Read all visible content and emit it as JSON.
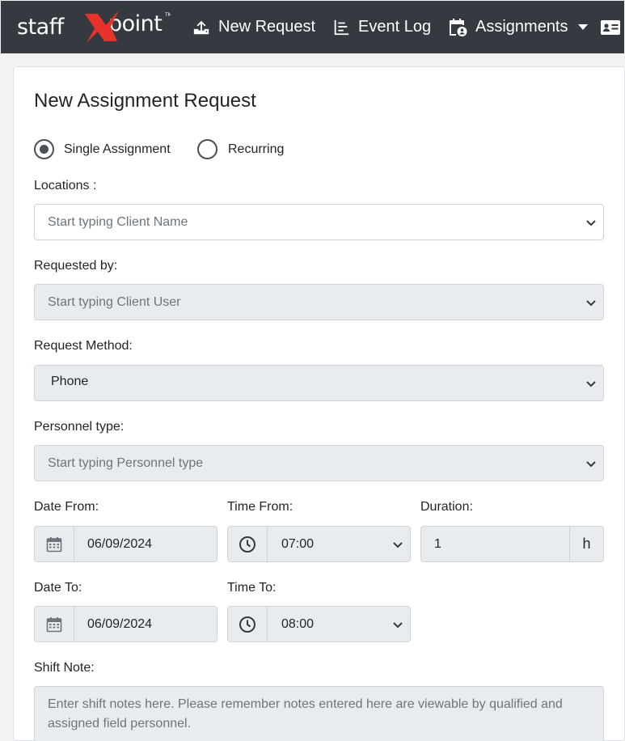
{
  "navbar": {
    "logo_text": "staffpoint",
    "new_request": "New Request",
    "event_log": "Event Log",
    "assignments": "Assignments"
  },
  "form": {
    "title": "New Assignment Request",
    "assignment_type": {
      "options": [
        "Single Assignment",
        "Recurring"
      ],
      "selected": "Single Assignment"
    },
    "locations": {
      "label": "Locations :",
      "placeholder": "Start typing Client Name"
    },
    "requested_by": {
      "label": "Requested by:",
      "placeholder": "Start typing Client User"
    },
    "request_method": {
      "label": "Request Method:",
      "value": "Phone"
    },
    "personnel_type": {
      "label": "Personnel type:",
      "placeholder": "Start typing Personnel type"
    },
    "date_from": {
      "label": "Date From:",
      "value": "06/09/2024"
    },
    "time_from": {
      "label": "Time From:",
      "value": "07:00"
    },
    "duration": {
      "label": "Duration:",
      "value": "1",
      "unit": "h"
    },
    "date_to": {
      "label": "Date To:",
      "value": "06/09/2024"
    },
    "time_to": {
      "label": "Time To:",
      "value": "08:00"
    },
    "shift_note": {
      "label": "Shift Note:",
      "placeholder": "Enter shift notes here. Please remember notes entered here are viewable by qualified and assigned field personnel."
    }
  },
  "colors": {
    "navbar_bg": "#343a40",
    "logo_accent": "#e8322b",
    "input_disabled_bg": "#e9ecef"
  },
  "icons": [
    "upload-icon",
    "list-chart-icon",
    "calendar-user-icon",
    "caret-down-icon",
    "id-card-icon",
    "calendar-icon",
    "clock-icon",
    "chevron-down-icon"
  ]
}
